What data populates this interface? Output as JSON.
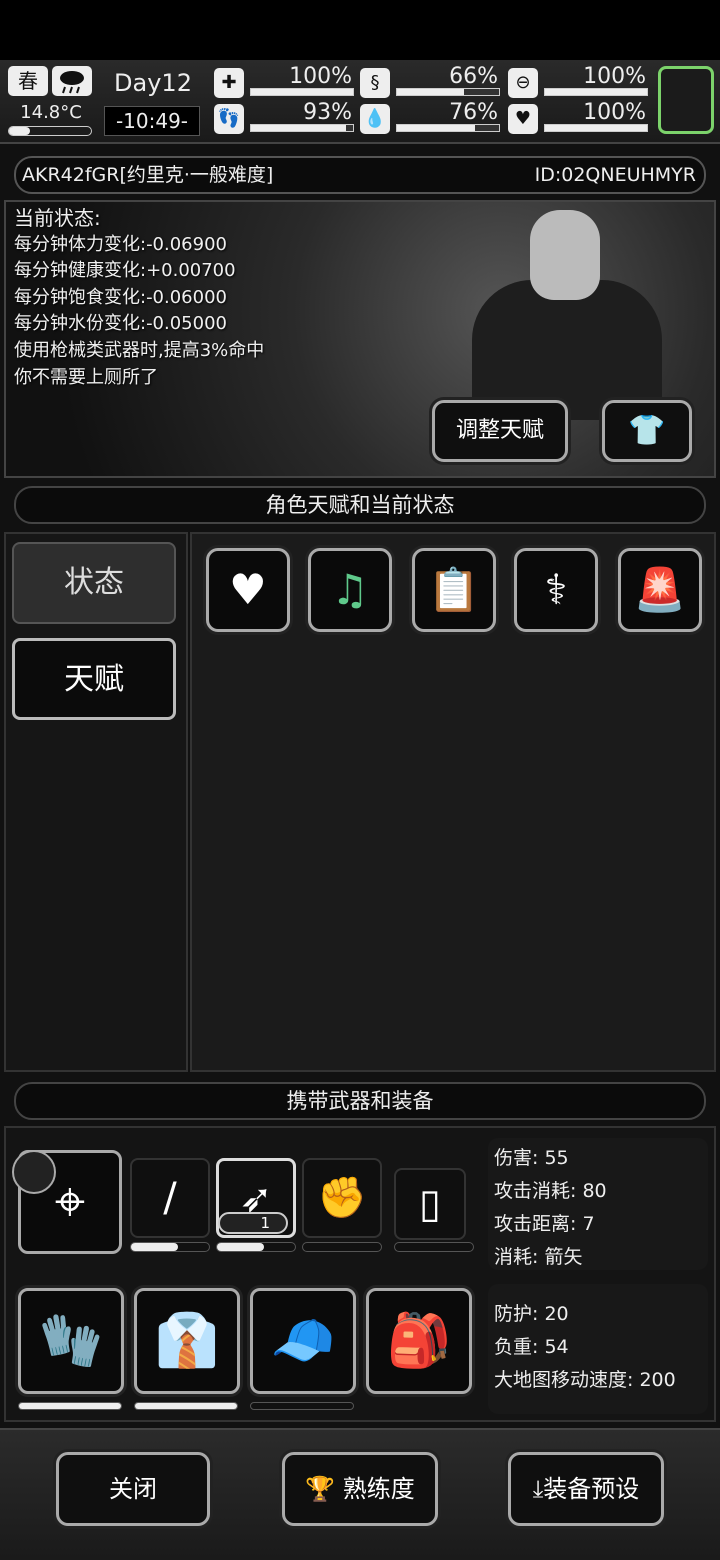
{
  "top": {
    "season": "春",
    "temperature": "14.8°C",
    "temperature_level": 0.25,
    "day": "Day12",
    "clock": "-10:49-",
    "stats": [
      {
        "icon": "medkit-icon",
        "value": "100%",
        "level": 1.0
      },
      {
        "icon": "stomach-icon",
        "value": "66%",
        "level": 0.66
      },
      {
        "icon": "toilet-icon",
        "value": "100%",
        "level": 1.0
      },
      {
        "icon": "foot-icon",
        "value": "93%",
        "level": 0.93
      },
      {
        "icon": "water-drop-icon",
        "value": "76%",
        "level": 0.76
      },
      {
        "icon": "heart-icon",
        "value": "100%",
        "level": 1.0
      }
    ]
  },
  "character": {
    "name": "AKR42fGR[约里克·一般难度]",
    "id": "ID:02QNEUHMYR"
  },
  "status": {
    "heading": "当前状态:",
    "lines": [
      "每分钟体力变化:-0.06900",
      "每分钟健康变化:+0.00700",
      "每分钟饱食变化:-0.06000",
      "每分钟水份变化:-0.05000",
      "使用枪械类武器时,提高3%命中",
      "你不需要上厕所了"
    ]
  },
  "buttons": {
    "adjust_talent": "调整天赋",
    "close": "关闭",
    "proficiency": "熟练度",
    "equip_preset": "装备预设"
  },
  "sections": {
    "talents_status": "角色天赋和当前状态",
    "weapons_gear": "携带武器和装备"
  },
  "tabs": {
    "status": "状态",
    "talent": "天赋"
  },
  "weapon_stats": {
    "damage": "伤害: 55",
    "attack_cost": "攻击消耗: 80",
    "attack_range": "攻击距离: 7",
    "consume": "消耗: 箭矢"
  },
  "ammo_count": "1",
  "weapon_durability": [
    0.6,
    0.6,
    0.0,
    0.0
  ],
  "gear_stats": {
    "defense": "防护: 20",
    "load": "负重: 54",
    "map_speed": "大地图移动速度: 200"
  },
  "gear_durability": [
    1.0,
    1.0,
    0.0
  ],
  "colors": {
    "accent_green": "#7cd36b"
  }
}
